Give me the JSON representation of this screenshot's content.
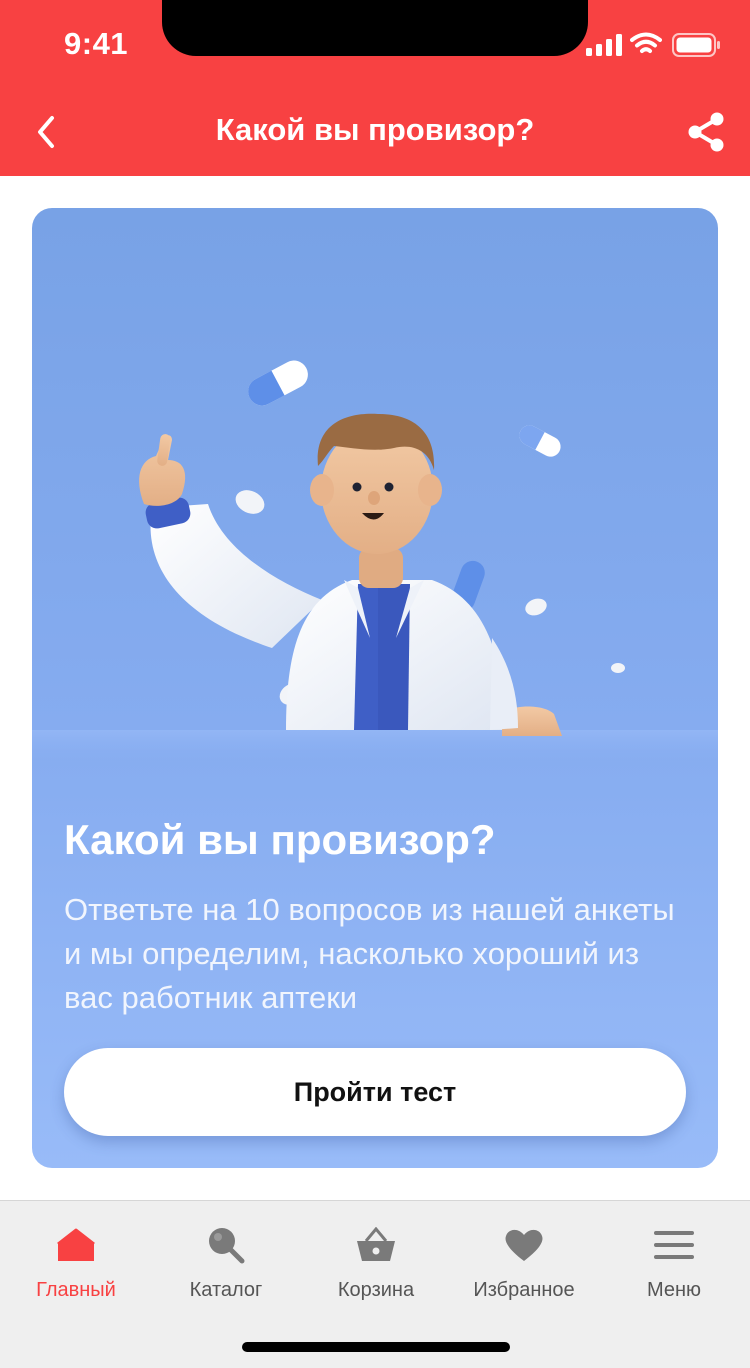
{
  "status_bar": {
    "time": "9:41"
  },
  "header": {
    "title": "Какой вы провизор?",
    "back_icon": "chevron-left-icon",
    "share_icon": "share-icon"
  },
  "quiz_card": {
    "title": "Какой вы провизор?",
    "description": "Ответьте на 10 вопросов из нашей анкеты и мы определим, насколько хороший из вас работник аптеки",
    "button_label": "Пройти тест"
  },
  "tab_bar": {
    "items": [
      {
        "label": "Главный",
        "icon": "home-icon",
        "active": true
      },
      {
        "label": "Каталог",
        "icon": "search-icon",
        "active": false
      },
      {
        "label": "Корзина",
        "icon": "basket-icon",
        "active": false
      },
      {
        "label": "Избранное",
        "icon": "heart-icon",
        "active": false
      },
      {
        "label": "Меню",
        "icon": "menu-icon",
        "active": false
      }
    ]
  },
  "colors": {
    "brand_red": "#F84142",
    "card_blue": "#86ACF0",
    "inactive_gray": "#7a7a7a"
  }
}
